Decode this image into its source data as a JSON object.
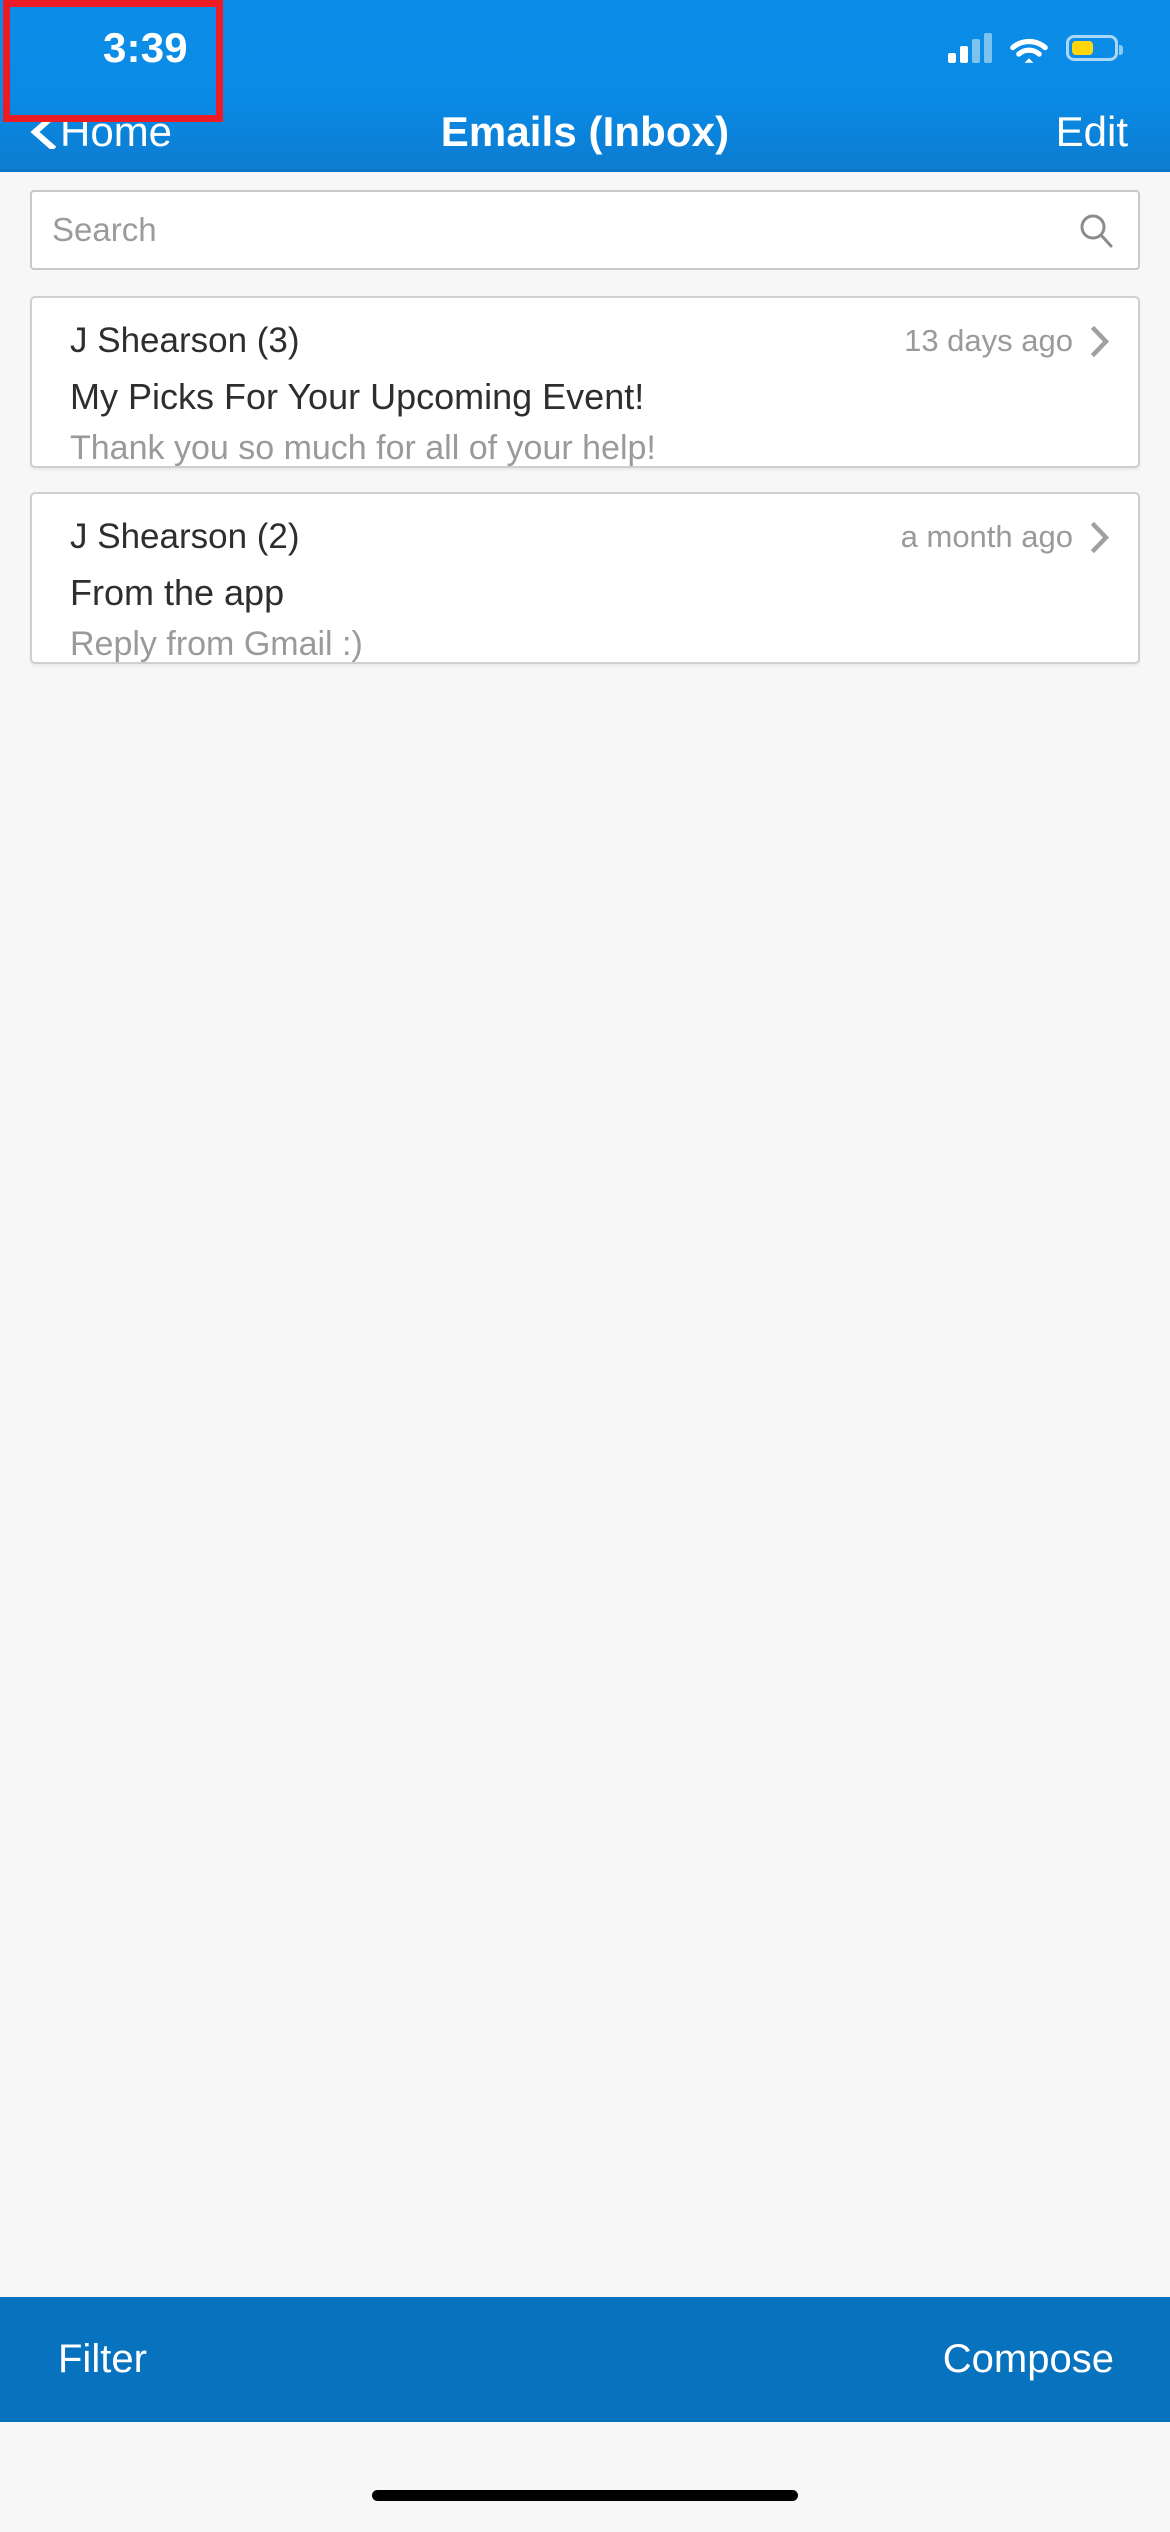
{
  "status_bar": {
    "time": "3:39",
    "signal_icon": "cellular-signal-icon",
    "signal_bars_filled": 2,
    "signal_bars_total": 4,
    "wifi_icon": "wifi-icon",
    "battery_icon": "battery-icon",
    "battery_level_percent": 45,
    "battery_color": "#ffd60a"
  },
  "nav_bar": {
    "back_label": "Home",
    "back_icon": "chevron-left-icon",
    "title": "Emails (Inbox)",
    "edit_label": "Edit",
    "background_color": "#0a8be6"
  },
  "search": {
    "value": "",
    "placeholder": "Search",
    "icon": "search-icon"
  },
  "emails": [
    {
      "sender": "J Shearson (3)",
      "time_ago": "13 days ago",
      "subject": "My Picks For Your Upcoming Event!",
      "preview": "Thank you so much for all of your help!",
      "disclosure_icon": "chevron-right-icon"
    },
    {
      "sender": "J Shearson (2)",
      "time_ago": "a month ago",
      "subject": "From the app",
      "preview": "Reply from Gmail :)",
      "disclosure_icon": "chevron-right-icon"
    }
  ],
  "toolbar": {
    "filter_label": "Filter",
    "compose_label": "Compose",
    "background_color": "#0772be",
    "highlight_color": "#ed1c24",
    "highlighted_item": "Filter"
  },
  "home_indicator": {
    "name": "home-indicator"
  }
}
